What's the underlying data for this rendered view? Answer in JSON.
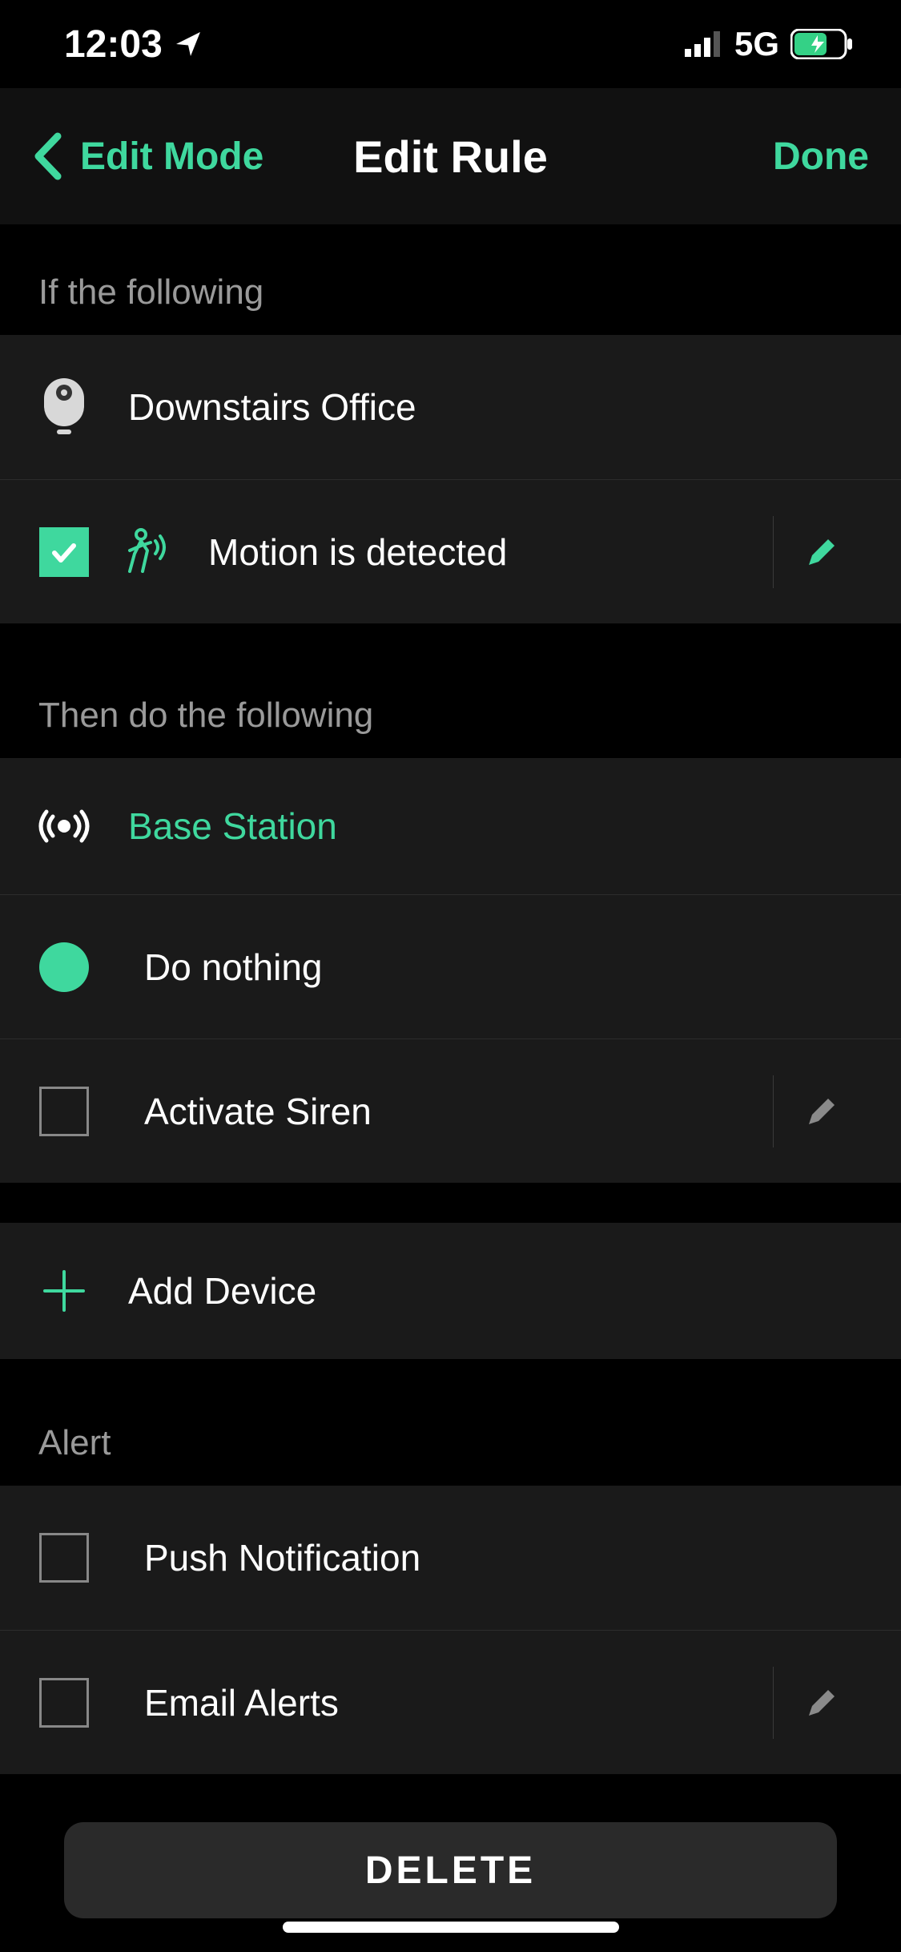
{
  "status": {
    "time": "12:03",
    "network": "5G"
  },
  "nav": {
    "back_label": "Edit Mode",
    "title": "Edit Rule",
    "done_label": "Done"
  },
  "if_section": {
    "header": "If the following",
    "device": "Downstairs Office",
    "trigger": "Motion is detected"
  },
  "then_section": {
    "header": "Then do the following",
    "device": "Base Station",
    "option_do_nothing": "Do nothing",
    "option_activate_siren": "Activate Siren",
    "add_device": "Add Device"
  },
  "alert_section": {
    "header": "Alert",
    "push": "Push Notification",
    "email": "Email Alerts"
  },
  "delete_label": "DELETE"
}
